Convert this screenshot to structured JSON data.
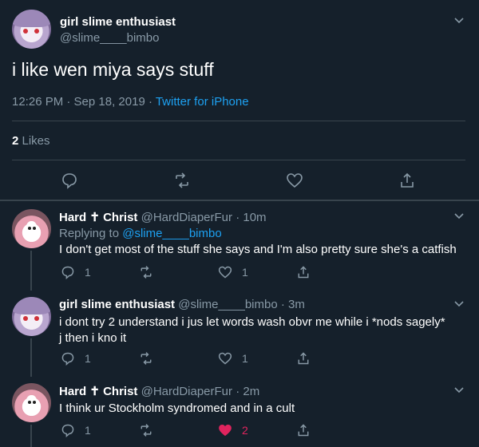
{
  "main_tweet": {
    "display_name": "girl slime enthusiast",
    "handle": "@slime____bimbo",
    "text": "i like wen miya says stuff",
    "time": "12:26 PM · Sep 18, 2019 · ",
    "source": "Twitter for iPhone",
    "likes_count": "2",
    "likes_label": " Likes",
    "icons": [
      "reply-icon",
      "retweet-icon",
      "like-icon",
      "share-icon"
    ]
  },
  "replies": [
    {
      "display_name": "Hard ✝ Christ",
      "handle": "@HardDiaperFur",
      "age": " · 10m",
      "replying_prefix": "Replying to ",
      "replying_to": "@slime____bimbo",
      "text": "I don't get most of the stuff she says and I'm also pretty sure she's a catfish",
      "reply_count": "1",
      "retweet_count": "",
      "like_count": "1"
    },
    {
      "display_name": "girl slime enthusiast",
      "handle": "@slime____bimbo",
      "age": " · 3m",
      "text": "i dont try 2 understand i jus let words wash obvr me while i *nods sagely* j then i kno it",
      "reply_count": "1",
      "retweet_count": "",
      "like_count": "1"
    },
    {
      "display_name": "Hard ✝ Christ",
      "handle": "@HardDiaperFur",
      "age": " · 2m",
      "text": "I think ur Stockholm syndromed and in a cult",
      "reply_count": "1",
      "retweet_count": "",
      "like_count": "2"
    }
  ],
  "colors": {
    "background": "#15202b",
    "secondary_text": "#8899a6",
    "link": "#1da1f2",
    "like_active": "#e0245e",
    "divider": "#38444d"
  }
}
